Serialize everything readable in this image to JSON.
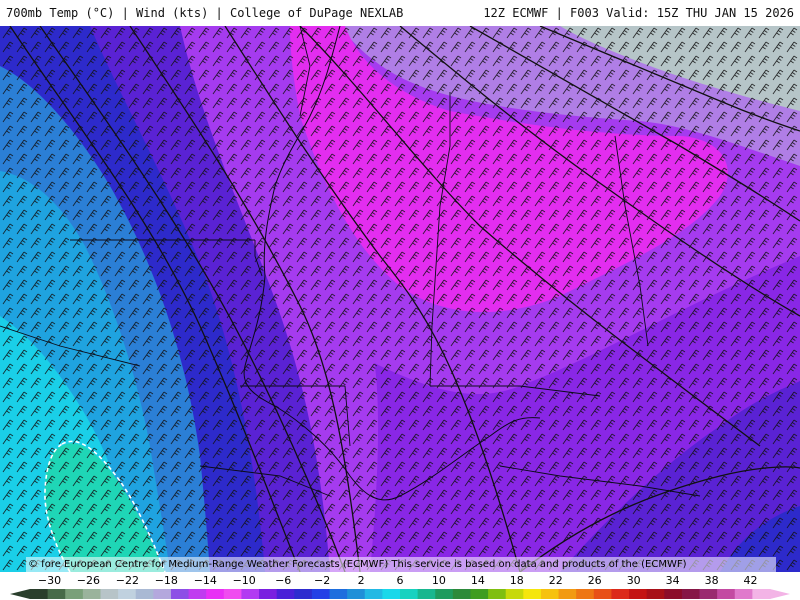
{
  "header": {
    "left": "700mb Temp (°C) | Wind (kts) | College of DuPage NEXLAB",
    "right": "12Z ECMWF | F003 Valid: 15Z THU JAN 15 2026"
  },
  "attribution": "© fore European Centre for Medium-Range Weather Forecasts (ECMWF)  This service is based on data and products of the (ECMWF)",
  "colorbar": {
    "unit": "°C",
    "labels": [
      "−30",
      "−26",
      "−22",
      "−18",
      "−14",
      "−10",
      "−6",
      "−2",
      "2",
      "6",
      "10",
      "14",
      "18",
      "22",
      "26",
      "30",
      "34",
      "38",
      "42"
    ],
    "min": -32,
    "max": 44,
    "step": 2,
    "colors": [
      "#2a3f2c",
      "#476b49",
      "#7aa07a",
      "#9ab39c",
      "#b7c4c8",
      "#c0d1df",
      "#a9b9d4",
      "#b4a8dd",
      "#8d4fe6",
      "#c03bf0",
      "#e830f5",
      "#f04cf0",
      "#b23af2",
      "#7a1fe0",
      "#4a20d8",
      "#2e2ccf",
      "#2440e6",
      "#1e6ede",
      "#1f90d8",
      "#22b9e4",
      "#1ad8ea",
      "#18d2c0",
      "#18b78f",
      "#1e9b5e",
      "#2c8a3a",
      "#3f9d20",
      "#7fbf10",
      "#c7d90a",
      "#f5e60c",
      "#f6c20e",
      "#f29a12",
      "#ee7614",
      "#e85017",
      "#dc2a1a",
      "#c41413",
      "#a81018",
      "#8c0c2a",
      "#861646",
      "#9a2a70",
      "#c34aa2",
      "#e07acc",
      "#f3b4e6"
    ],
    "palette": {
      "cold_gray": "#b6c5c8",
      "lavender": "#b07ee6",
      "magenta": "#e32df0",
      "violet": "#a53bef",
      "purple": "#8927e6",
      "indigo": "#5a22d4",
      "dark_blue": "#2d2acb",
      "blue": "#2b5ed6",
      "steel_blue": "#2b7fd6",
      "sky_blue": "#1fa3e0",
      "cyan": "#1acfe8",
      "teal": "#1fd6b6"
    }
  },
  "map": {
    "layers": [
      "700mb temperature shading",
      "wind barbs",
      "isotherm contours",
      "state/province borders",
      "coastline"
    ],
    "zero_isotherm_label": "dashed white contour"
  }
}
